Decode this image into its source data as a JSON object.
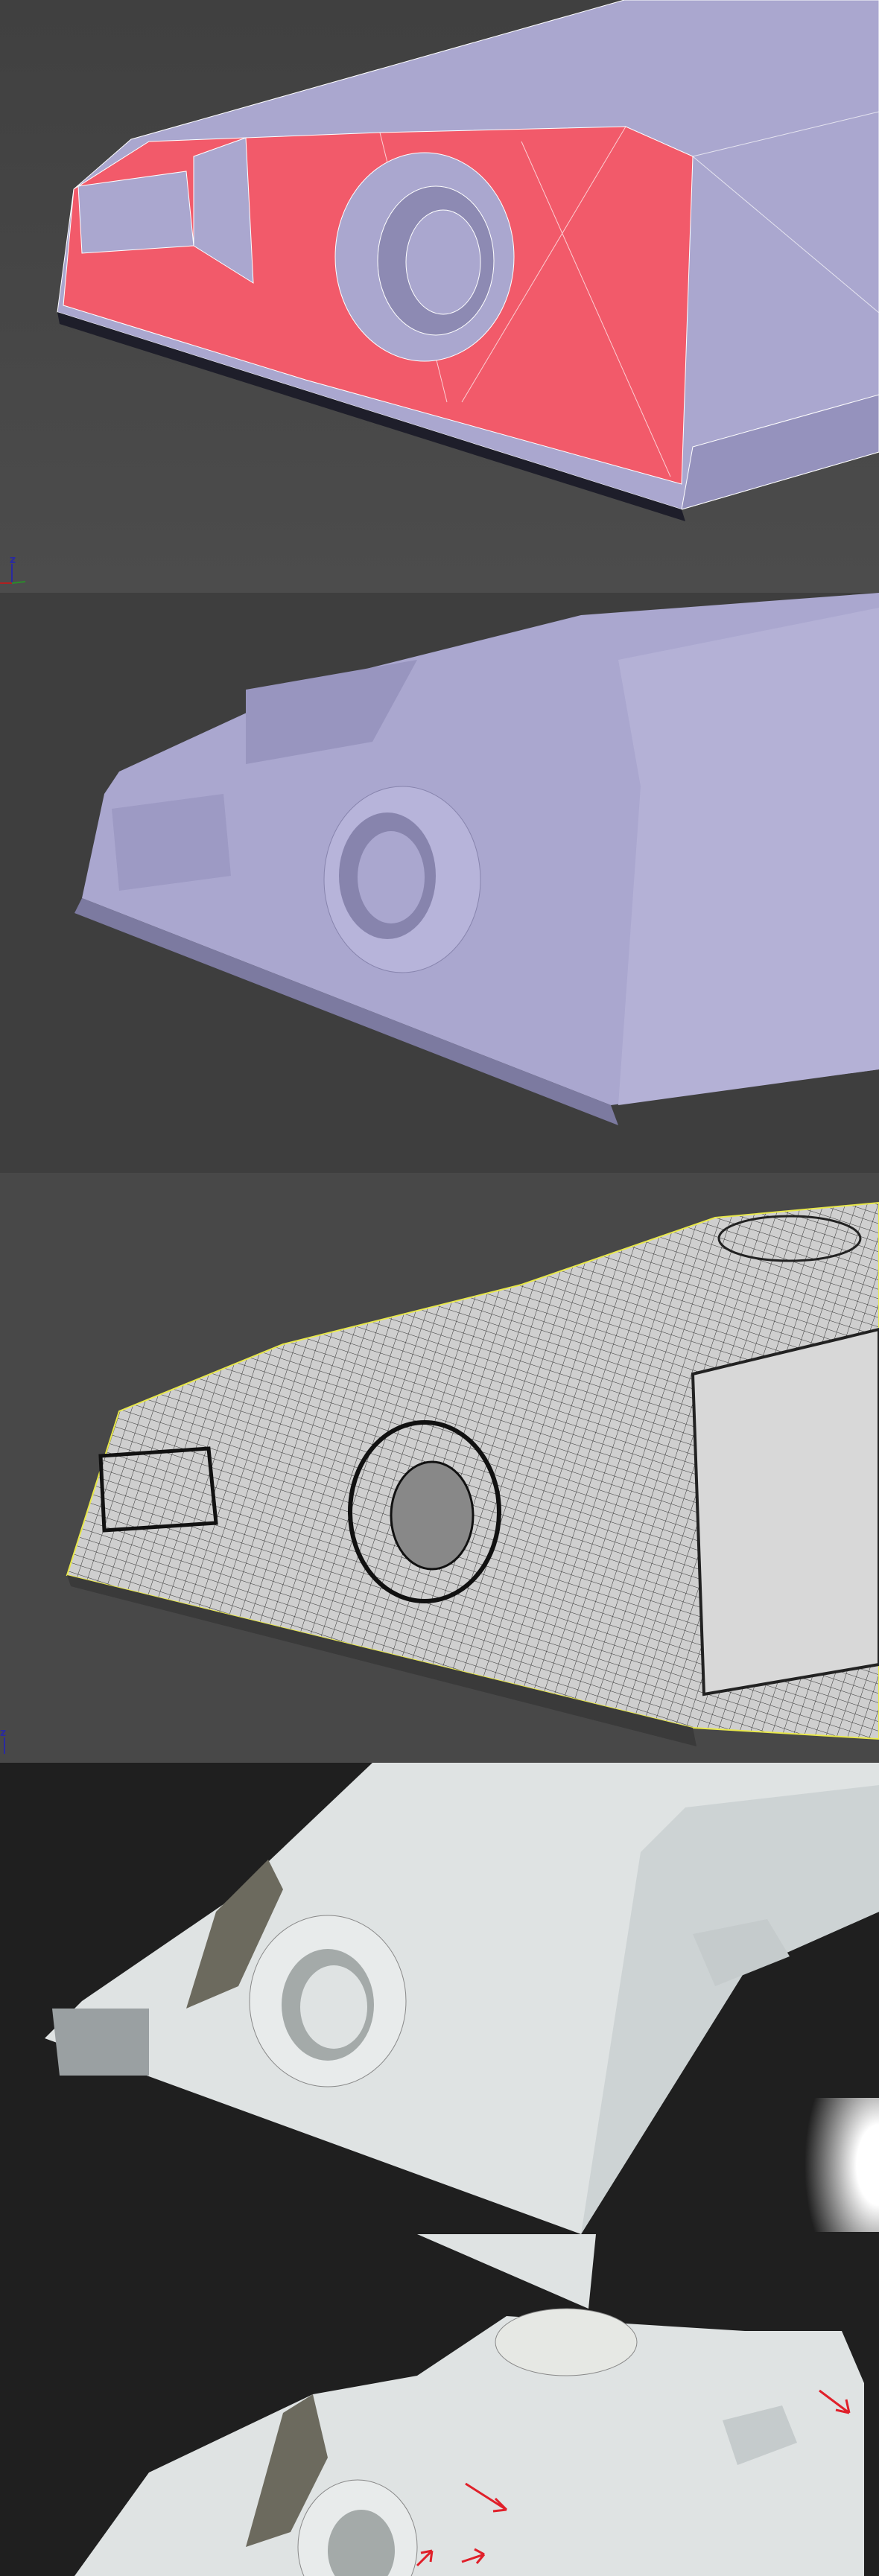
{
  "panels": [
    {
      "id": "face-selection-view",
      "gizmo": {
        "z_label": "z"
      }
    },
    {
      "id": "shaded-low-poly-view"
    },
    {
      "id": "subdivided-wireframe-view",
      "gizmo": {
        "z_label": "z"
      }
    },
    {
      "id": "clay-render-view"
    },
    {
      "id": "clay-render-annotated-view"
    }
  ],
  "colors": {
    "viewport_bg": "#4a4a4a",
    "render_bg": "#1f1f1f",
    "model_lavender": "#aaa7cf",
    "selection_red": "#f25a6a",
    "wire_outline": "#e8e84a",
    "clay": "#dfe3e3",
    "annotation_red": "#e0202a"
  }
}
